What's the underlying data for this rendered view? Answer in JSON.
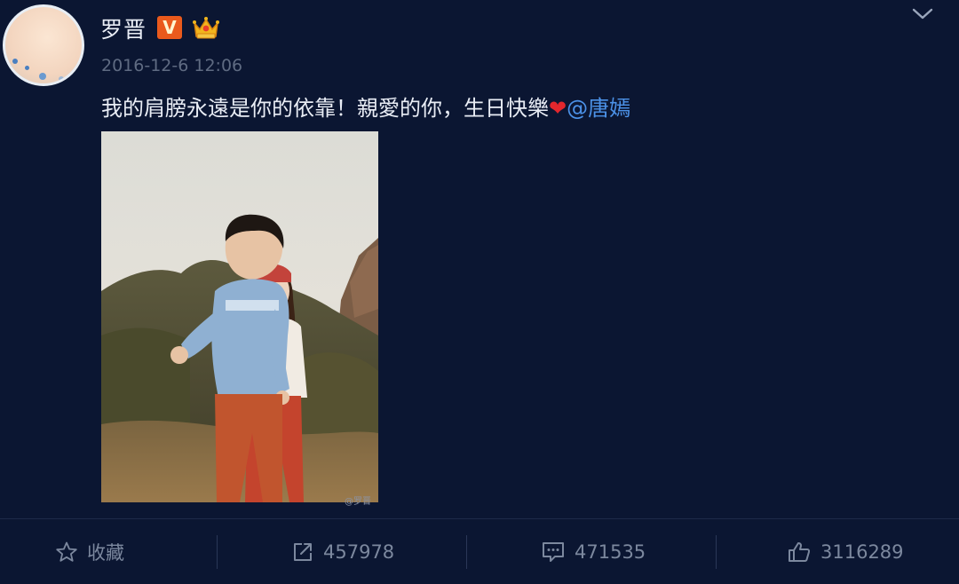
{
  "post": {
    "author": "罗晋",
    "verified_badge": "V",
    "timestamp": "2016-12-6 12:06",
    "text_main": "我的肩膀永遠是你的依靠！親愛的你，生日快樂",
    "heart": "❤",
    "mention": "@唐嫣",
    "image_watermark": "@罗晋"
  },
  "actions": {
    "favorite_label": "收藏",
    "repost_count": "457978",
    "comment_count": "471535",
    "like_count": "3116289"
  },
  "icons": {
    "avatar": "avatar",
    "verified": "verified-v-icon",
    "vip_crown": "crown-icon",
    "menu": "chevron-down-icon",
    "favorite": "star-icon",
    "repost": "share-icon",
    "comment": "comment-icon",
    "like": "thumbs-up-icon"
  },
  "colors": {
    "background": "#0b1632",
    "text": "#e9edf5",
    "muted": "#7c889e",
    "mention": "#4c92e8",
    "heart": "#e2272d",
    "verified": "#ea5a1c"
  }
}
